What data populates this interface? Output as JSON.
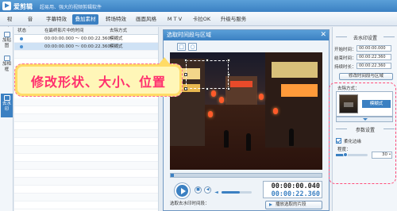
{
  "app": {
    "name": "爱剪辑",
    "subtitle": "超易用、强大的视频剪辑软件"
  },
  "tabs": [
    {
      "label": "视　频"
    },
    {
      "label": "音　频"
    },
    {
      "label": "字幕特效"
    },
    {
      "label": "叠加素材",
      "active": true
    },
    {
      "label": "转场特效"
    },
    {
      "label": "画面风格"
    },
    {
      "label": "M T V"
    },
    {
      "label": "卡拉OK"
    },
    {
      "label": "升级与服务"
    }
  ],
  "sidebar": [
    {
      "label": "加贴图"
    },
    {
      "label": "加相框"
    },
    {
      "label": "去水印",
      "active": true
    }
  ],
  "list": {
    "headers": [
      "状态",
      "在最终影片中的时间",
      "去除方式"
    ],
    "rows": [
      {
        "time": "00:00:00.000 ～ 00:00:22.360",
        "method": "模糊式"
      },
      {
        "time": "00:00:00.000 ～ 00:00:22.360",
        "method": "模糊式"
      }
    ]
  },
  "callout": {
    "text": "修改形状、大小、位置"
  },
  "dialog": {
    "title": "选取时间段与区域",
    "mode_rect": "□",
    "mode_ellipse": "○",
    "time_current": "00:00:00.040",
    "time_total": "00:00:22.360",
    "range_heading": "选取去水印时间段：",
    "start_label": "开始时间：",
    "start_value": "00:00:00.000",
    "end_label": "结束时间：",
    "end_value": "00:00:22.360",
    "play_selected": "播放选取的片段",
    "progress": 0.02,
    "volume": 0.6
  },
  "rpanel": {
    "title": "去水印设置",
    "start_label": "开始时间：",
    "start_value": "00:00:00.000",
    "end_label": "结束时间：",
    "end_value": "00:00:22.360",
    "duration_label": "持续时长：",
    "duration_value": "00:00:22.360",
    "modify_button": "修改时间段与区域",
    "method_label": "去除方式：",
    "method_value": "模糊式",
    "params_title": "参数设置",
    "soften_label": "柔化边缘",
    "strength_label": "程度：",
    "strength_value": "30",
    "strength_ratio": 0.3
  },
  "colors": {
    "accent": "#3b80c2",
    "highlight": "#ff2f6e"
  }
}
